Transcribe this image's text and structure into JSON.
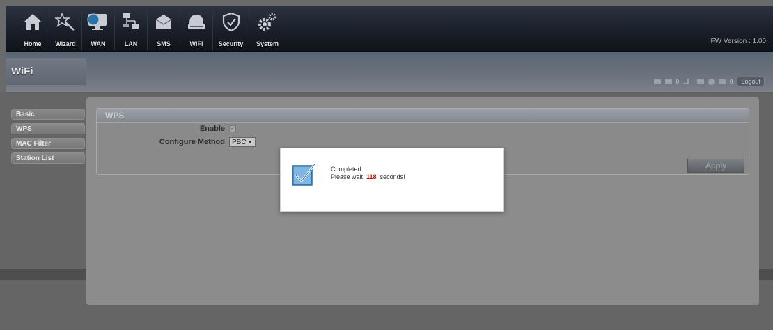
{
  "nav": {
    "items": [
      {
        "label": "Home",
        "icon": "home-icon"
      },
      {
        "label": "Wizard",
        "icon": "wand-icon"
      },
      {
        "label": "WAN",
        "icon": "monitor-globe-icon"
      },
      {
        "label": "LAN",
        "icon": "network-icon"
      },
      {
        "label": "SMS",
        "icon": "envelope-icon"
      },
      {
        "label": "WiFi",
        "icon": "router-icon"
      },
      {
        "label": "Security",
        "icon": "shield-icon"
      },
      {
        "label": "System",
        "icon": "gears-icon"
      }
    ],
    "fw_version": "FW Version : 1.00"
  },
  "header": {
    "title": "WiFi",
    "status": {
      "count1": "0",
      "count2": "0",
      "logout_label": "Logout"
    }
  },
  "sidebar": {
    "items": [
      {
        "label": "Basic"
      },
      {
        "label": "WPS"
      },
      {
        "label": "MAC Filter"
      },
      {
        "label": "Station List"
      }
    ]
  },
  "wps": {
    "section_title": "WPS",
    "enable_label": "Enable",
    "enable_checked": true,
    "method_label": "Configure Method",
    "method_value": "PBC",
    "apply_label": "Apply"
  },
  "modal": {
    "line1": "Completed.",
    "wait_prefix": "Please wait",
    "seconds": "118",
    "wait_suffix": "seconds!"
  },
  "colors": {
    "accent_red": "#d00000",
    "nav_dark": "#1a2029"
  }
}
